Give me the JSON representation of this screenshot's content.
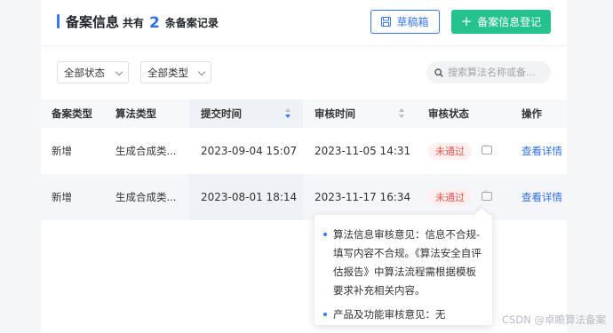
{
  "header": {
    "title": "备案信息",
    "count_prefix": "共有",
    "count_value": "2",
    "count_suffix": "条备案记录",
    "draft_button": "草稿箱",
    "register_button": "备案信息登记"
  },
  "filters": {
    "status": "全部状态",
    "type": "全部类型",
    "search_placeholder": "搜索算法名称或备..."
  },
  "table": {
    "columns": [
      "备案类型",
      "算法类型",
      "提交时间",
      "审核时间",
      "审核状态",
      "操作"
    ],
    "rows": [
      {
        "filing_type": "新增",
        "algo_type": "生成合成类...",
        "submit_time": "2023-09-04 15:07",
        "review_time": "2023-11-05 14:31",
        "status": "未通过",
        "action": "查看详情"
      },
      {
        "filing_type": "新增",
        "algo_type": "生成合成类...",
        "submit_time": "2023-08-01 18:14",
        "review_time": "2023-11-17 16:34",
        "status": "未通过",
        "action": "查看详情"
      }
    ]
  },
  "tooltip": {
    "items": [
      "算法信息审核意见：信息不合规-填写内容不合规。《算法安全自评估报告》中算法流程需根据模板要求补充相关内容。",
      "产品及功能审核意见：无"
    ]
  },
  "watermark": "CSDN @卓瞻算法备案",
  "colors": {
    "accent": "#3a79f5",
    "success_button": "#25c28f",
    "reject": "#f0514a"
  }
}
